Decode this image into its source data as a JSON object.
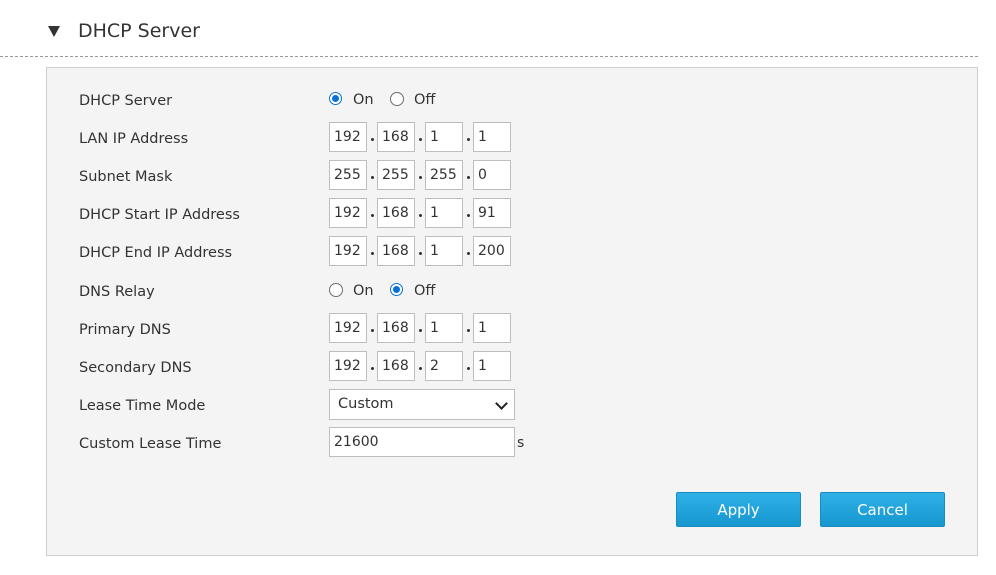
{
  "section": {
    "title": "DHCP Server"
  },
  "form": {
    "dhcp_server": {
      "label": "DHCP Server",
      "options": [
        "On",
        "Off"
      ],
      "selected": "On"
    },
    "lan_ip": {
      "label": "LAN IP Address",
      "octets": [
        "192",
        "168",
        "1",
        "1"
      ]
    },
    "subnet_mask": {
      "label": "Subnet Mask",
      "octets": [
        "255",
        "255",
        "255",
        "0"
      ]
    },
    "dhcp_start": {
      "label": "DHCP Start IP Address",
      "octets": [
        "192",
        "168",
        "1",
        "91"
      ]
    },
    "dhcp_end": {
      "label": "DHCP End IP Address",
      "octets": [
        "192",
        "168",
        "1",
        "200"
      ]
    },
    "dns_relay": {
      "label": "DNS Relay",
      "options": [
        "On",
        "Off"
      ],
      "selected": "Off"
    },
    "primary_dns": {
      "label": "Primary DNS",
      "octets": [
        "192",
        "168",
        "1",
        "1"
      ]
    },
    "secondary_dns": {
      "label": "Secondary DNS",
      "octets": [
        "192",
        "168",
        "2",
        "1"
      ]
    },
    "lease_mode": {
      "label": "Lease Time Mode",
      "value": "Custom"
    },
    "custom_lease": {
      "label": "Custom Lease Time",
      "value": "21600",
      "unit": "s"
    }
  },
  "buttons": {
    "apply": "Apply",
    "cancel": "Cancel"
  },
  "colors": {
    "accent": "#0a70d6",
    "button": "#1ba0d9"
  }
}
